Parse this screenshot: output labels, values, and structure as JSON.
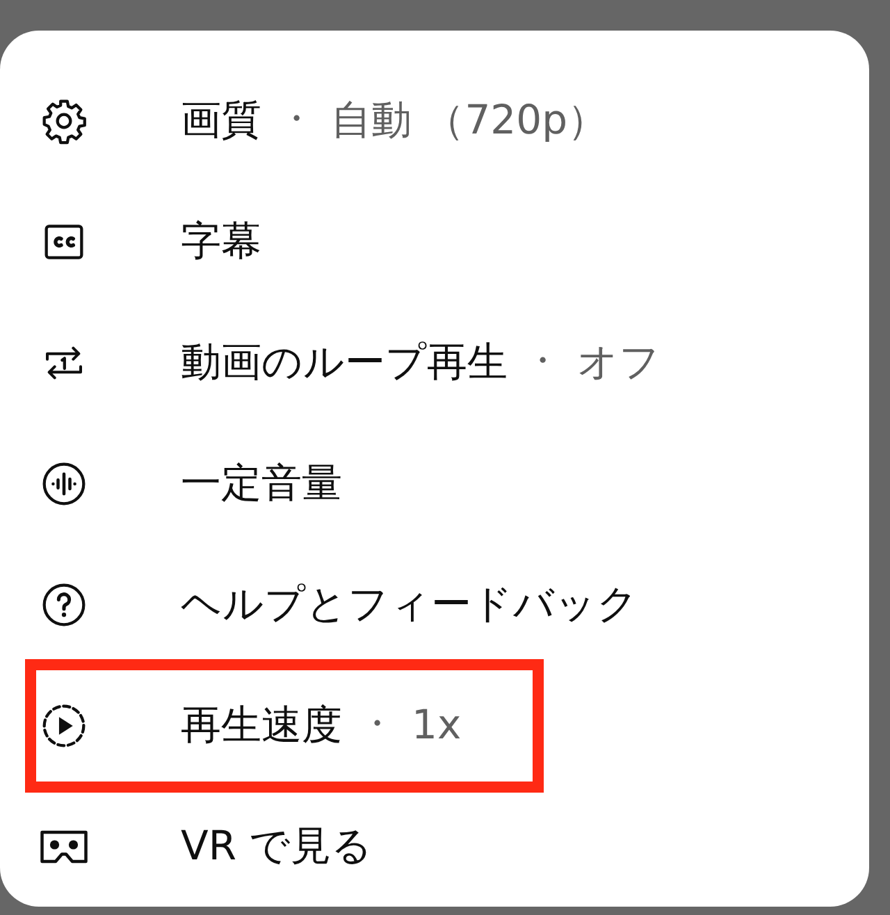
{
  "sheet": {
    "items": [
      {
        "kind": "quality",
        "label": "画質",
        "separator": "・",
        "value": "自動 （720p）",
        "highlighted": false
      },
      {
        "kind": "captions",
        "label": "字幕",
        "highlighted": false
      },
      {
        "kind": "loop",
        "label": "動画のループ再生",
        "separator": "・",
        "value": "オフ",
        "highlighted": false
      },
      {
        "kind": "volume",
        "label": "一定音量",
        "highlighted": false
      },
      {
        "kind": "help",
        "label": "ヘルプとフィードバック",
        "highlighted": false
      },
      {
        "kind": "speed",
        "label": "再生速度",
        "separator": "・",
        "value": "1x",
        "highlighted": true
      },
      {
        "kind": "vr",
        "label": "VR で見る",
        "highlighted": false
      }
    ]
  }
}
